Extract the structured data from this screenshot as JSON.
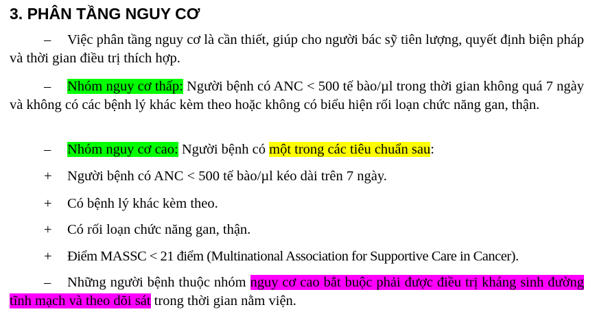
{
  "heading": "3. PHÂN TẦNG NGUY CƠ",
  "dash": "–",
  "plus": "+",
  "p1": {
    "text": "Việc phân tầng nguy cơ là cần thiết, giúp cho người bác sỹ tiên lượng, quyết định biện pháp và thời gian điều trị thích hợp."
  },
  "p2": {
    "label": "Nhóm nguy cơ thấp:",
    "text": " Người bệnh có ANC < 500 tế bào/µl trong thời gian không quá 7 ngày và không có các bệnh lý khác kèm theo hoặc không có biểu hiện rối loạn chức năng gan, thận."
  },
  "p3": {
    "label": "Nhóm nguy cơ cao:",
    "text_before": " Người bệnh có ",
    "highlight": "một trong các tiêu chuẩn sau",
    "text_after": ":"
  },
  "criteria": [
    "Người bệnh có ANC < 500 tế bào/µl kéo dài trên 7 ngày.",
    "Có bệnh lý khác kèm theo.",
    "Có rối loạn chức năng gan, thận.",
    "Điểm MASSC < 21 điểm (Multinational Association for Supportive Care in Cancer)."
  ],
  "p4": {
    "text_before": "Những người bệnh thuộc nhóm ",
    "highlight": "nguy cơ cao bắt buộc phải được điều trị kháng sinh đường tĩnh mạch và theo dõi sát",
    "text_after": " trong thời gian nằm viện."
  }
}
